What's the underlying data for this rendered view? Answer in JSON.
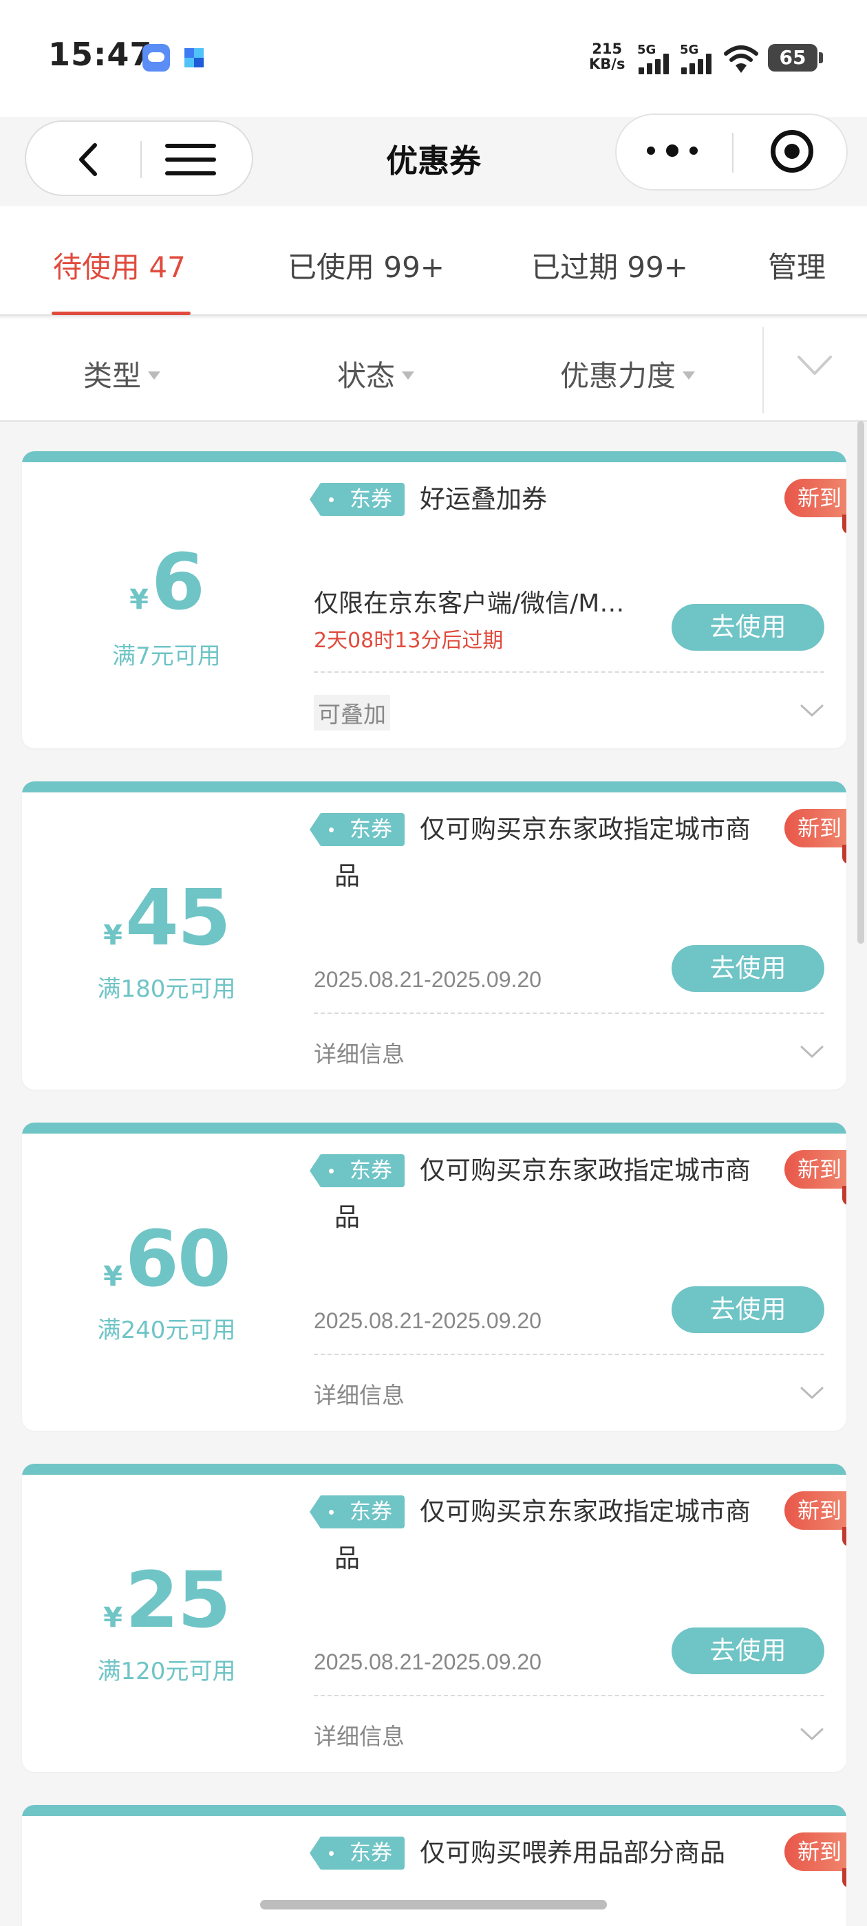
{
  "status_bar": {
    "time": "15:47",
    "net_speed_value": "215",
    "net_speed_unit": "KB/s",
    "signal1_label": "5G",
    "signal2_label": "5G",
    "battery": "65"
  },
  "nav": {
    "title": "优惠券"
  },
  "tabs": [
    {
      "label": "待使用 47"
    },
    {
      "label": "已使用 99+"
    },
    {
      "label": "已过期 99+"
    },
    {
      "label": "管理"
    }
  ],
  "filters": [
    {
      "label": "类型"
    },
    {
      "label": "状态"
    },
    {
      "label": "优惠力度"
    }
  ],
  "coupons": [
    {
      "yen": "¥",
      "amount": "6",
      "condition": "满7元可用",
      "tag": "东券",
      "title": "好运叠加券",
      "title_cont": "",
      "badge": "新到",
      "desc": "仅限在京东客户端/微信/M…",
      "expire": "2天08时13分后过期",
      "button": "去使用",
      "footer": "可叠加"
    },
    {
      "yen": "¥",
      "amount": "45",
      "condition": "满180元可用",
      "tag": "东券",
      "title": "仅可购买京东家政指定城市商",
      "title_cont": "品",
      "badge": "新到",
      "date": "2025.08.21-2025.09.20",
      "button": "去使用",
      "footer": "详细信息"
    },
    {
      "yen": "¥",
      "amount": "60",
      "condition": "满240元可用",
      "tag": "东券",
      "title": "仅可购买京东家政指定城市商",
      "title_cont": "品",
      "badge": "新到",
      "date": "2025.08.21-2025.09.20",
      "button": "去使用",
      "footer": "详细信息"
    },
    {
      "yen": "¥",
      "amount": "25",
      "condition": "满120元可用",
      "tag": "东券",
      "title": "仅可购买京东家政指定城市商",
      "title_cont": "品",
      "badge": "新到",
      "date": "2025.08.21-2025.09.20",
      "button": "去使用",
      "footer": "详细信息"
    },
    {
      "tag": "东券",
      "title": "仅可购买喂养用品部分商品",
      "badge": "新到"
    }
  ],
  "colors": {
    "accent": "#6fc4c6",
    "active_tab": "#e04b3d",
    "badge": "#e8574a"
  }
}
